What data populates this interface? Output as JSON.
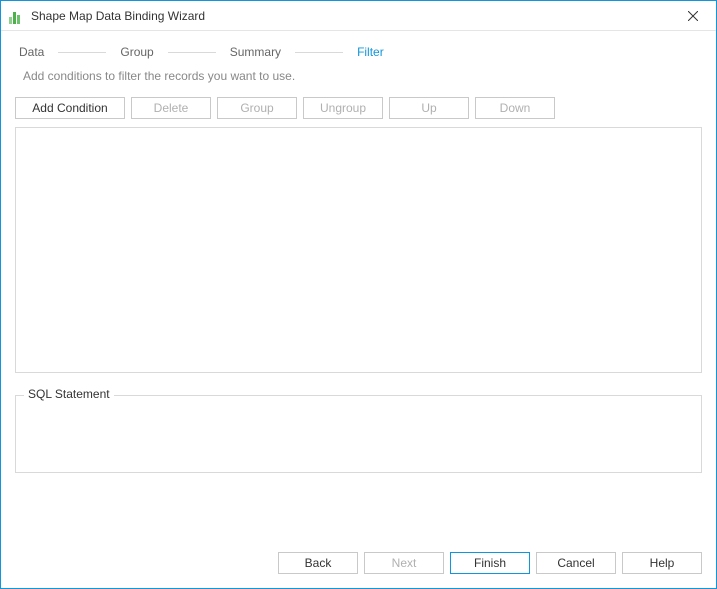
{
  "window": {
    "title": "Shape Map Data Binding Wizard"
  },
  "steps": {
    "items": [
      "Data",
      "Group",
      "Summary",
      "Filter"
    ],
    "activeIndex": 3
  },
  "subtitle": "Add conditions to filter the records you want to use.",
  "toolbar": {
    "addCondition": "Add Condition",
    "delete": "Delete",
    "group": "Group",
    "ungroup": "Ungroup",
    "up": "Up",
    "down": "Down"
  },
  "sqlStatement": {
    "label": "SQL Statement",
    "value": ""
  },
  "footer": {
    "back": "Back",
    "next": "Next",
    "finish": "Finish",
    "cancel": "Cancel",
    "help": "Help"
  }
}
